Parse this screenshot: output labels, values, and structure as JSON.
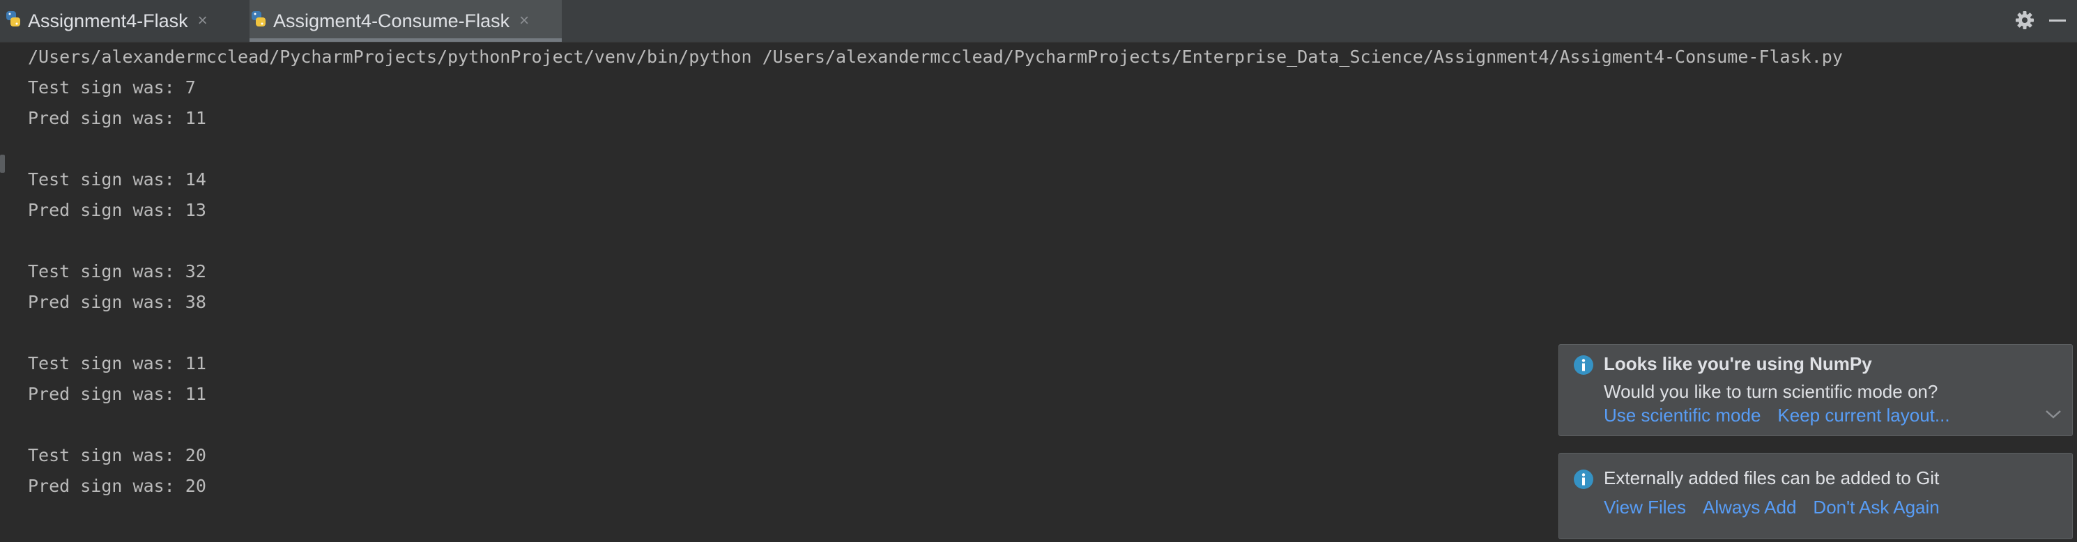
{
  "tabs": [
    {
      "label": "Assignment4-Flask",
      "active": false
    },
    {
      "label": "Assigment4-Consume-Flask",
      "active": true
    }
  ],
  "console": {
    "lines": [
      "/Users/alexandermcclead/PycharmProjects/pythonProject/venv/bin/python /Users/alexandermcclead/PycharmProjects/Enterprise_Data_Science/Assignment4/Assigment4-Consume-Flask.py",
      "Test sign was: 7",
      "Pred sign was: 11",
      "",
      "Test sign was: 14",
      "Pred sign was: 13",
      "",
      "Test sign was: 32",
      "Pred sign was: 38",
      "",
      "Test sign was: 11",
      "Pred sign was: 11",
      "",
      "Test sign was: 20",
      "Pred sign was: 20"
    ]
  },
  "notifications": {
    "numpy": {
      "title": "Looks like you're using NumPy",
      "message": "Would you like to turn scientific mode on?",
      "actions": [
        "Use scientific mode",
        "Keep current layout..."
      ]
    },
    "git": {
      "message": "Externally added files can be added to Git",
      "actions": [
        "View Files",
        "Always Add",
        "Don't Ask Again"
      ]
    }
  },
  "icons": {
    "python": "python-file-icon",
    "close": "close-icon",
    "settings": "gear-icon",
    "minimize": "minimize-icon",
    "info": "info-icon",
    "expand": "chevron-down-icon"
  },
  "colors": {
    "background": "#2b2b2b",
    "tabbar": "#3c3f41",
    "console_text": "#bbbbbb",
    "notification_bg": "#4b4d4f",
    "link": "#589df6",
    "info_icon": "#3592c4"
  }
}
